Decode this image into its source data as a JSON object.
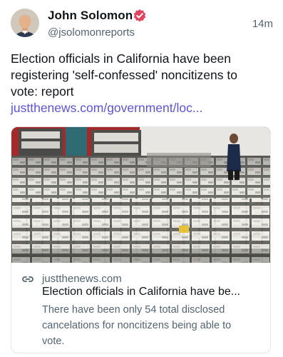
{
  "author": {
    "name": "John Solomon",
    "handle": "@jsolomonreports",
    "verified": true
  },
  "timestamp": "14m",
  "post": {
    "text": "Election officials in California have been registering 'self-confessed' noncitizens to vote: report ",
    "link_text": "justthenews.com/government/loc..."
  },
  "link_card": {
    "domain": "justthenews.com",
    "title": "Election officials in California have be...",
    "description": "There have been only 54 total disclosed cancelations for noncitizens being able to vote."
  },
  "icons": {
    "verified": "verified-badge-icon",
    "link": "link-icon"
  },
  "colors": {
    "link": "#5b53d8",
    "verified": "#e0455e",
    "secondary_text": "#536471"
  }
}
